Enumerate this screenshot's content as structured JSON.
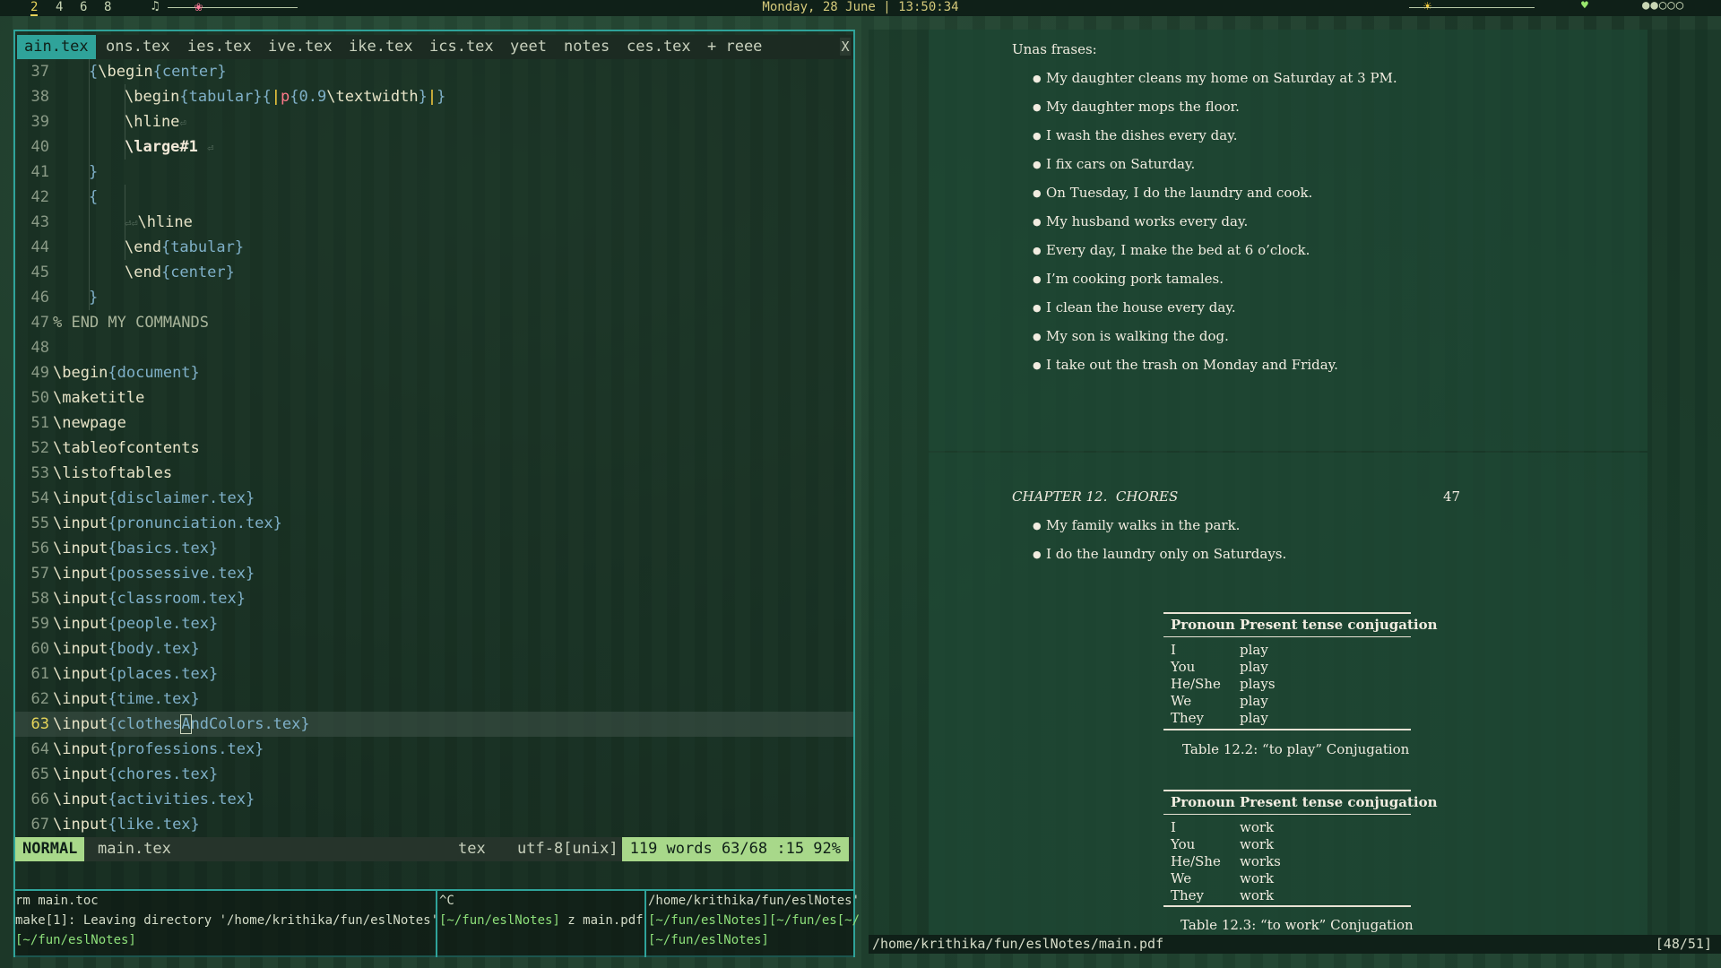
{
  "topbar": {
    "workspaces": [
      "2",
      "4",
      "6",
      "8"
    ],
    "clock": "Monday, 28 June |  13:50:34",
    "icons": {
      "music": "music-note-icon",
      "media": "flower-icon",
      "brightness": "sun-icon",
      "battery": "heart-icon",
      "menu": "dots-icon"
    },
    "volume_level": 0.24,
    "brightness_level": 0.17,
    "dots": "●●○○○",
    "accent": "#e8d35a"
  },
  "editor": {
    "tabs": [
      "ain.tex",
      "ons.tex",
      "ies.tex",
      "ive.tex",
      "ike.tex",
      "ics.tex",
      "yeet",
      "notes",
      "ces.tex",
      "+ reee"
    ],
    "close": "X",
    "lines": {
      "l37": {
        "n": "37",
        "a": "{",
        "b": "\\begin",
        "c": "{center}"
      },
      "l38": {
        "n": "38",
        "a": "\\begin",
        "b": "{tabular}{",
        "p1": "|",
        "p2": "p",
        "p3": "{0.9",
        "p4": "\\textwidth",
        "p5": "}",
        "p6": "|",
        "p7": "}"
      },
      "l39": {
        "n": "39",
        "a": "\\hline",
        "m": "⏎"
      },
      "l40": {
        "n": "40",
        "a": "\\large",
        "b": "#1",
        "m": "⏎"
      },
      "l41": {
        "n": "41",
        "a": "}"
      },
      "l42": {
        "n": "42",
        "a": "{"
      },
      "l43": {
        "n": "43",
        "m": "⏎⏎",
        "a": "\\hline"
      },
      "l44": {
        "n": "44",
        "a": "\\end",
        "b": "{tabular}"
      },
      "l45": {
        "n": "45",
        "a": "\\end",
        "b": "{center}"
      },
      "l46": {
        "n": "46",
        "a": "}"
      },
      "l47": {
        "n": "47",
        "a": "% END MY COMMANDS"
      },
      "l48": {
        "n": "48"
      },
      "l49": {
        "n": "49",
        "a": "\\begin",
        "b": "{document}"
      },
      "l50": {
        "n": "50",
        "a": "\\maketitle"
      },
      "l51": {
        "n": "51",
        "a": "\\newpage"
      },
      "l52": {
        "n": "52",
        "a": "\\tableofcontents"
      },
      "l53": {
        "n": "53",
        "a": "\\listoftables"
      },
      "l54": {
        "n": "54",
        "a": "\\input",
        "b": "{disclaimer.tex}"
      },
      "l55": {
        "n": "55",
        "a": "\\input",
        "b": "{pronunciation.tex}"
      },
      "l56": {
        "n": "56",
        "a": "\\input",
        "b": "{basics.tex}"
      },
      "l57": {
        "n": "57",
        "a": "\\input",
        "b": "{possessive.tex}"
      },
      "l58": {
        "n": "58",
        "a": "\\input",
        "b": "{classroom.tex}"
      },
      "l59": {
        "n": "59",
        "a": "\\input",
        "b": "{people.tex}"
      },
      "l60": {
        "n": "60",
        "a": "\\input",
        "b": "{body.tex}"
      },
      "l61": {
        "n": "61",
        "a": "\\input",
        "b": "{places.tex}"
      },
      "l62": {
        "n": "62",
        "a": "\\input",
        "b": "{time.tex}"
      },
      "l63": {
        "n": "63",
        "a": "\\input",
        "b1": "{clothes",
        "b2": "A",
        "b3": "ndColors.tex}"
      },
      "l64": {
        "n": "64",
        "a": "\\input",
        "b": "{professions.tex}"
      },
      "l65": {
        "n": "65",
        "a": "\\input",
        "b": "{chores.tex}"
      },
      "l66": {
        "n": "66",
        "a": "\\input",
        "b": "{activities.tex}"
      },
      "l67": {
        "n": "67",
        "a": "\\input",
        "b": "{like.tex}"
      }
    },
    "status": {
      "mode": "NORMAL",
      "file": "main.tex",
      "filetype": "tex",
      "encoding": "utf-8[unix]",
      "stats": "119 words 63/68 :15 92%"
    }
  },
  "terminals": {
    "t1": {
      "l1": "rm main.toc",
      "l2": "make[1]: Leaving directory '/home/krithika/fun/eslNotes'",
      "prompt": "[~/fun/eslNotes]"
    },
    "t2": {
      "l1": "^C",
      "prompt": "[~/fun/eslNotes]",
      "cmd": " z main.pdf"
    },
    "t3": {
      "l1": "/home/krithika/fun/eslNotes'",
      "l2": "[~/fun/eslNotes][~/fun/es[~/",
      "prompt": "[~/fun/eslNotes]"
    }
  },
  "pdf": {
    "intro": "Unas frases:",
    "bullets1": [
      "My daughter cleans my home on Saturday at 3 PM.",
      "My daughter mops the floor.",
      "I wash the dishes every day.",
      "I fix cars on Saturday.",
      "On Tuesday, I do the laundry and cook.",
      "My husband works every day.",
      "Every day, I make the bed at 6 o’clock.",
      "I’m cooking pork tamales.",
      "I clean the house every day.",
      "My son is walking the dog.",
      "I take out the trash on Monday and Friday."
    ],
    "header_chapter": "CHAPTER 12.  CHORES",
    "header_page": "47",
    "bullets2": [
      "My family walks in the park.",
      "I do the laundry only on Saturdays."
    ],
    "table1": {
      "headers": [
        "Pronoun",
        "Present tense conjugation"
      ],
      "pronouns": [
        "I",
        "You",
        "He/She",
        "We",
        "They"
      ],
      "forms": [
        "play",
        "play",
        "plays",
        "play",
        "play"
      ],
      "caption": "Table 12.2: “to play” Conjugation"
    },
    "table2": {
      "headers": [
        "Pronoun",
        "Present tense conjugation"
      ],
      "pronouns": [
        "I",
        "You",
        "He/She",
        "We",
        "They"
      ],
      "forms": [
        "work",
        "work",
        "works",
        "work",
        "work"
      ],
      "caption": "Table 12.3: “to work” Conjugation"
    },
    "path": "/home/krithika/fun/eslNotes/main.pdf",
    "page_indicator": "[48/51]"
  }
}
